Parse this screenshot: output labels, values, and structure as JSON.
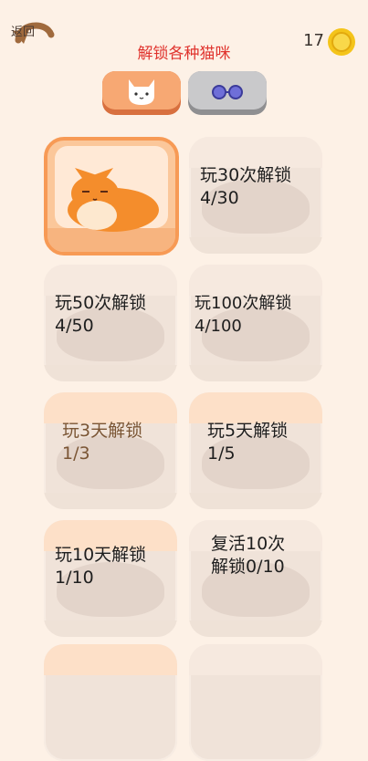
{
  "header": {
    "back_label": "返回",
    "title": "解锁各种猫咪",
    "coin_count": "17"
  },
  "tabs": [
    {
      "icon": "cat-face-icon",
      "selected": true
    },
    {
      "icon": "glasses-icon",
      "selected": false
    }
  ],
  "cards": [
    {
      "label": "",
      "status": "unlocked"
    },
    {
      "label": "玩30次解锁\n4/30",
      "status": "locked"
    },
    {
      "label": "玩50次解锁\n4/50",
      "status": "locked"
    },
    {
      "label": "玩100次解锁\n4/100",
      "status": "locked"
    },
    {
      "label": "玩3天解锁\n1/3",
      "status": "locked"
    },
    {
      "label": "玩5天解锁\n1/5",
      "status": "locked"
    },
    {
      "label": "玩10天解锁\n1/10",
      "status": "locked"
    },
    {
      "label": "复活10次\n解锁0/10",
      "status": "locked"
    }
  ],
  "colors": {
    "background": "#fdf1e6",
    "title": "#e0342e",
    "selected_border": "#f79a55",
    "coin": "#f4c41a"
  }
}
